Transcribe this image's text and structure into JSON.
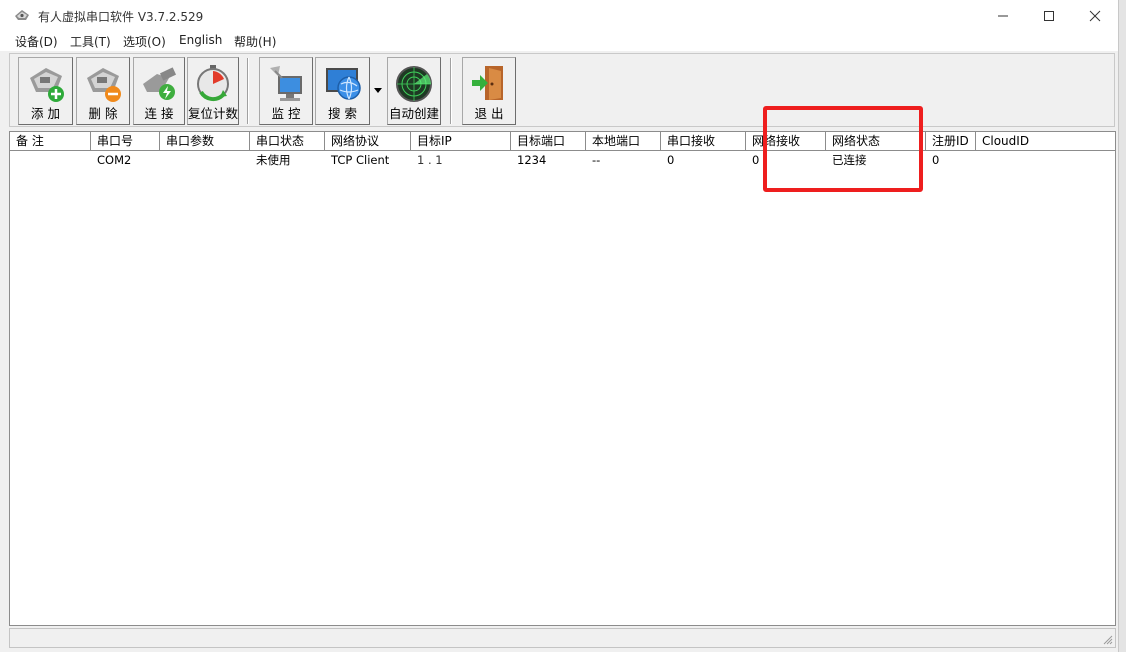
{
  "window": {
    "title": "有人虚拟串口软件 V3.7.2.529",
    "minimize_icon": "minimize-icon",
    "maximize_icon": "maximize-icon",
    "close_icon": "close-icon"
  },
  "menu": {
    "items": [
      "设备(D)",
      "工具(T)",
      "选项(O)",
      "English",
      "帮助(H)"
    ]
  },
  "toolbar": {
    "add": "添 加",
    "delete": "删 除",
    "connect": "连 接",
    "reset": "复位计数",
    "monitor": "监 控",
    "search": "搜 索",
    "auto_create": "自动创建",
    "exit": "退 出"
  },
  "table": {
    "headers": [
      "备 注",
      "串口号",
      "串口参数",
      "串口状态",
      "网络协议",
      "目标IP",
      "目标端口",
      "本地端口",
      "串口接收",
      "网络接收",
      "网络状态",
      "注册ID",
      "CloudID"
    ],
    "rows": [
      {
        "note": "",
        "port": "COM2",
        "params": "",
        "port_status": "未使用",
        "protocol": "TCP Client",
        "target_ip": "1 . 1",
        "target_port": "1234",
        "local_port": "--",
        "serial_rx": "0",
        "net_rx": "0",
        "net_status": "已连接",
        "reg_id": "0",
        "cloud_id": ""
      }
    ]
  },
  "colors": {
    "highlight": "#ee1e1e",
    "window_bg": "#f0f0f0"
  }
}
